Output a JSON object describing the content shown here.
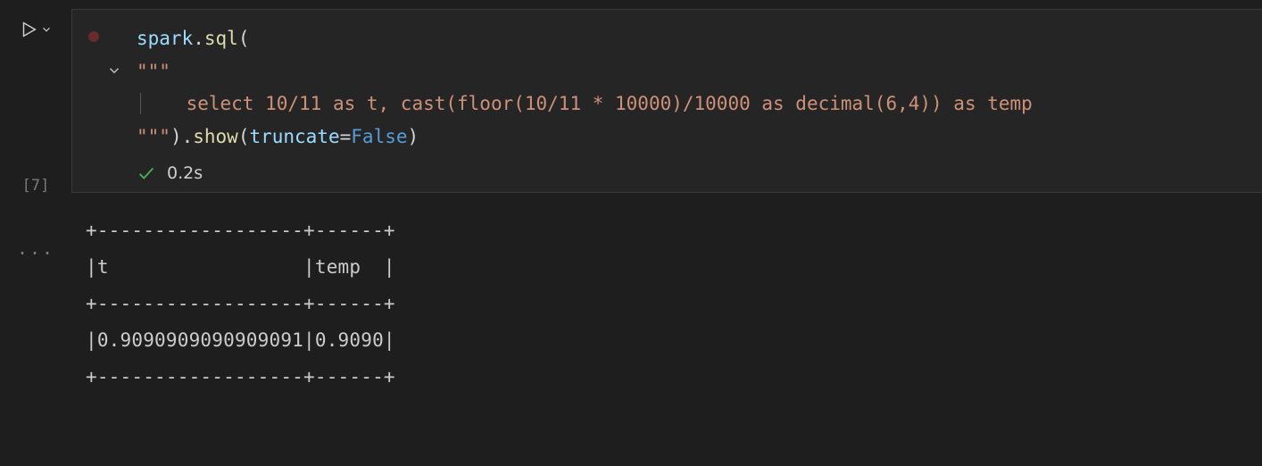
{
  "cell": {
    "execution_count": "[7]",
    "code": {
      "line1": {
        "spark": "spark",
        "dot": ".",
        "sql": "sql",
        "lparen": "("
      },
      "line2": {
        "triple_open": "\"\"\""
      },
      "line3": {
        "indent": "    ",
        "query": "select 10/11 as t, cast(floor(10/11 * 10000)/10000 as decimal(6,4)) as temp"
      },
      "line4": {
        "triple_close": "\"\"\"",
        "rparen_dot": ").",
        "show": "show",
        "lparen": "(",
        "param": "truncate",
        "eq": "=",
        "val": "False",
        "rparen": ")"
      }
    },
    "status_time": "0.2s"
  },
  "output": {
    "l1": "+------------------+------+",
    "l2": "|t                 |temp  |",
    "l3": "+------------------+------+",
    "l4": "|0.9090909090909091|0.9090|",
    "l5": "+------------------+------+"
  },
  "ellipsis": "...",
  "icons": {
    "play": "play-icon",
    "chevron": "chevron-down-icon",
    "fold": "chevron-down-icon",
    "check": "check-icon"
  }
}
